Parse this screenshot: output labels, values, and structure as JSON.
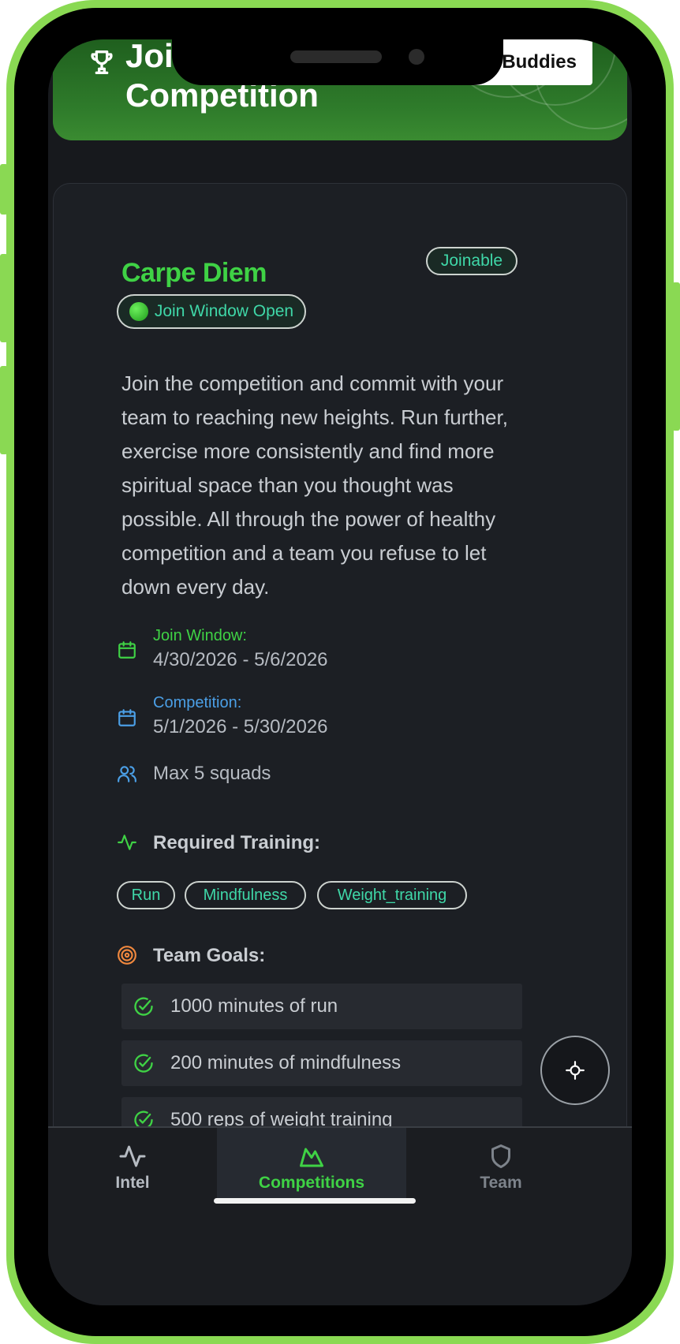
{
  "header": {
    "title": "Join Competition",
    "buddies_label": "Buddies"
  },
  "competition": {
    "name": "Carpe Diem",
    "badge": "Joinable",
    "window_status": "Join Window Open",
    "description": "Join the competition and commit with your team to reaching new heights. Run further, exercise more consistently and find more spiritual space than you thought was possible. All through the power of healthy competition and a team you refuse to let down every day.",
    "join_window_label": "Join Window:",
    "join_window_value": "4/30/2026 - 5/6/2026",
    "competition_label": "Competition:",
    "competition_value": "5/1/2026 - 5/30/2026",
    "max_squads": "Max 5 squads",
    "required_training_label": "Required Training:",
    "training_tags": [
      "Run",
      "Mindfulness",
      "Weight_training"
    ],
    "team_goals_label": "Team Goals:",
    "goals": [
      "1000 minutes of run",
      "200 minutes of mindfulness",
      "500 reps of weight training"
    ]
  },
  "nav": {
    "items": [
      {
        "label": "Intel",
        "icon": "activity-icon"
      },
      {
        "label": "Competitions",
        "icon": "mountain-icon"
      },
      {
        "label": "Team",
        "icon": "shield-icon"
      }
    ],
    "active": "Competitions"
  },
  "colors": {
    "accent_green": "#3fd245",
    "teal": "#3fd8a8",
    "blue": "#4b9fe6",
    "orange": "#f0883e",
    "frame": "#8ad953",
    "background": "#17191d"
  }
}
